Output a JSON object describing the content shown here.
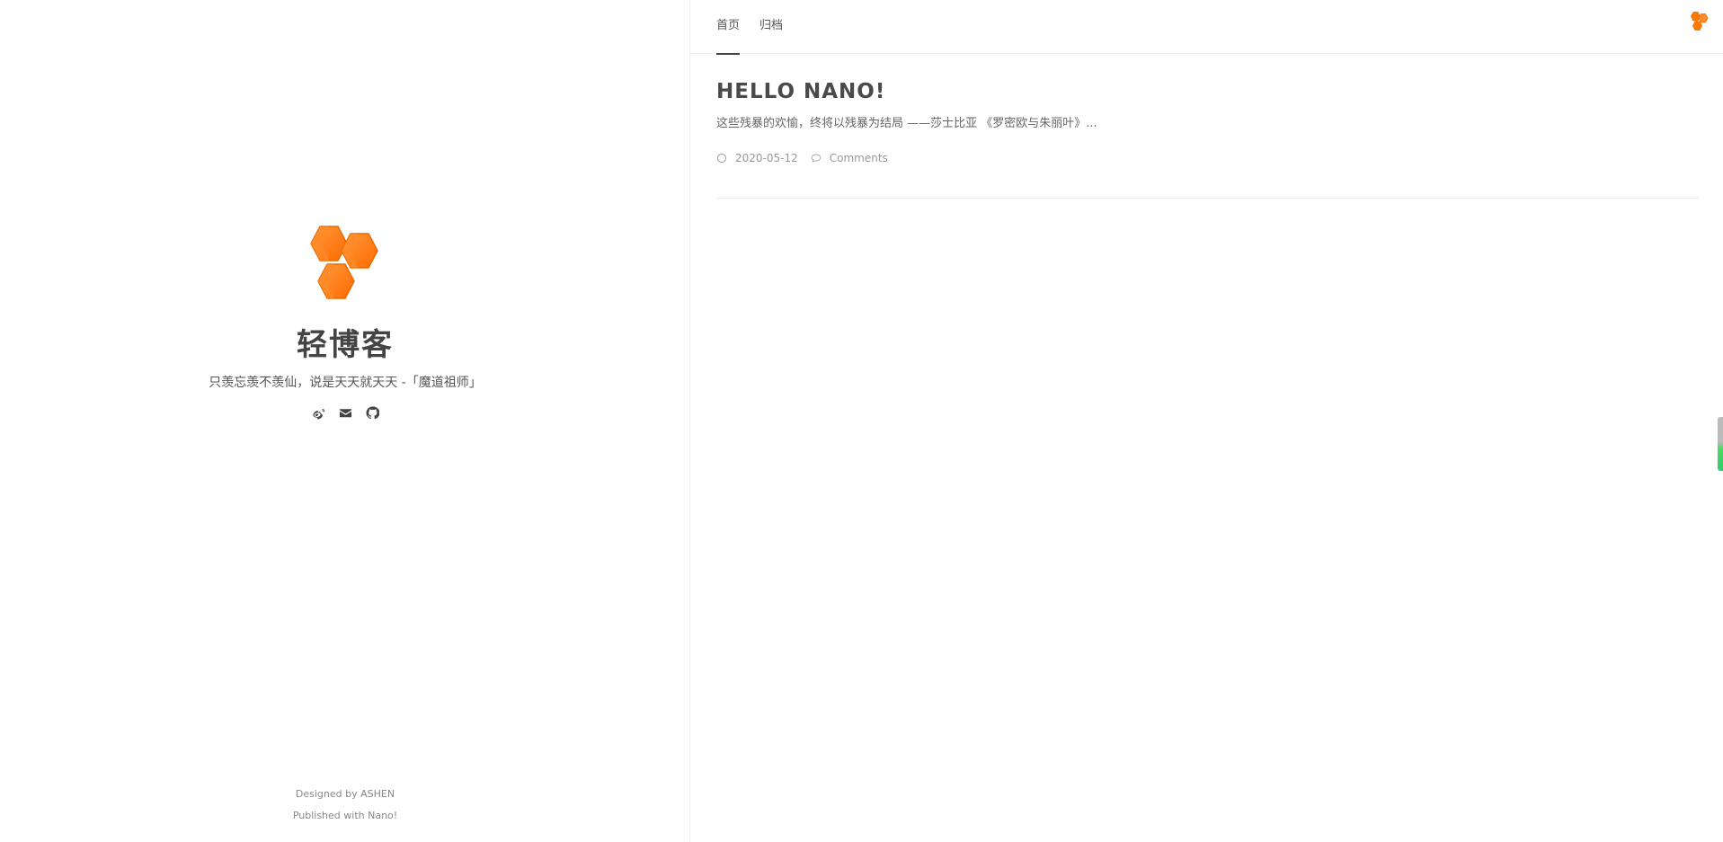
{
  "sidebar": {
    "logo_name": "honeycomb-logo",
    "title": "轻博客",
    "motto": "只羡忘羡不羡仙，说是天天就天天 -「魔道祖师」",
    "social": [
      {
        "icon": "weibo-icon"
      },
      {
        "icon": "mail-icon"
      },
      {
        "icon": "github-icon"
      }
    ],
    "footer": {
      "designed_by": "Designed by ASHEN",
      "published_with": "Published with Nano!"
    }
  },
  "nav": {
    "tabs": [
      {
        "label": "首页",
        "active": true
      },
      {
        "label": "归档",
        "active": false
      }
    ]
  },
  "posts": [
    {
      "title": "HELLO NANO!",
      "excerpt": "这些残暴的欢愉，终将以残暴为结局 ——莎士比亚 《罗密欧与朱丽叶》...",
      "date": "2020-05-12",
      "comments_label": "Comments"
    }
  ],
  "colors": {
    "accent": "#ff7a00",
    "accent_light": "#ff9a3c",
    "text_dark": "#444444",
    "scroll_green": "#2ecc71"
  }
}
